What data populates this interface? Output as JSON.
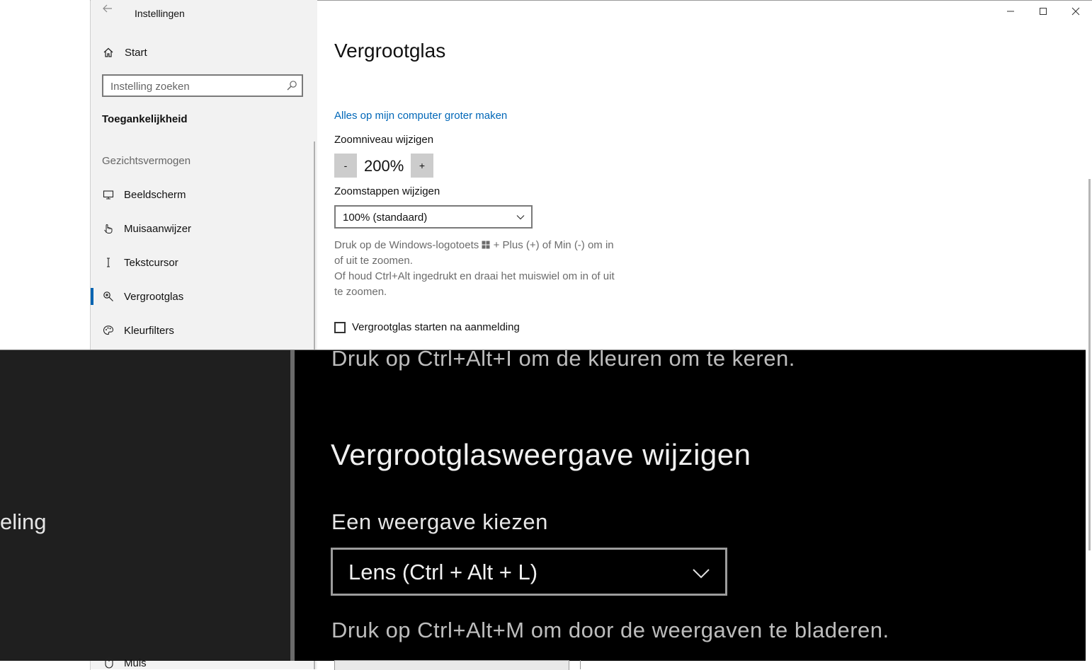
{
  "window": {
    "title": "Instellingen",
    "controls": [
      "—",
      "☐",
      "✕"
    ]
  },
  "sidebar": {
    "start_label": "Start",
    "search_placeholder": "Instelling zoeken",
    "group_title": "Toegankelijkheid",
    "section_title": "Gezichtsvermogen",
    "items": [
      {
        "label": "Beeldscherm",
        "icon": "monitor-icon"
      },
      {
        "label": "Muisaanwijzer",
        "icon": "pointer-icon"
      },
      {
        "label": "Tekstcursor",
        "icon": "text-cursor-icon"
      },
      {
        "label": "Vergrootglas",
        "icon": "magnifier-icon",
        "selected": true
      },
      {
        "label": "Kleurfilters",
        "icon": "palette-icon"
      }
    ],
    "below_item": "Muis"
  },
  "main": {
    "title": "Vergrootglas",
    "link": "Alles op mijn computer groter maken",
    "zoom_label": "Zoomniveau wijzigen",
    "zoom_minus": "-",
    "zoom_value": "200%",
    "zoom_plus": "+",
    "steps_label": "Zoomstappen wijzigen",
    "steps_value": "100% (standaard)",
    "help_line1a": "Druk op de Windows-logotoets",
    "help_line1b": "+ Plus (+) of Min (-) om in",
    "help_line2": "of uit te zoomen.",
    "help_line3": "Of houd Ctrl+Alt ingedrukt en draai het muiswiel om in of uit",
    "help_line4": "te zoomen.",
    "checkbox_label": "Vergrootglas starten na aanmelding"
  },
  "lens": {
    "top_text": "Druk op Ctrl+Alt+I om de kleuren om te keren.",
    "heading": "Vergrootglasweergave wijzigen",
    "label": "Een weergave kiezen",
    "select_value": "Lens (Ctrl + Alt + L)",
    "help": "Druk op Ctrl+Alt+M om door de weergaven te bladeren.",
    "left_text": "eling"
  },
  "colors": {
    "accent": "#0063b1",
    "link": "#0067b8",
    "sidebar_bg": "#f2f2f2"
  }
}
